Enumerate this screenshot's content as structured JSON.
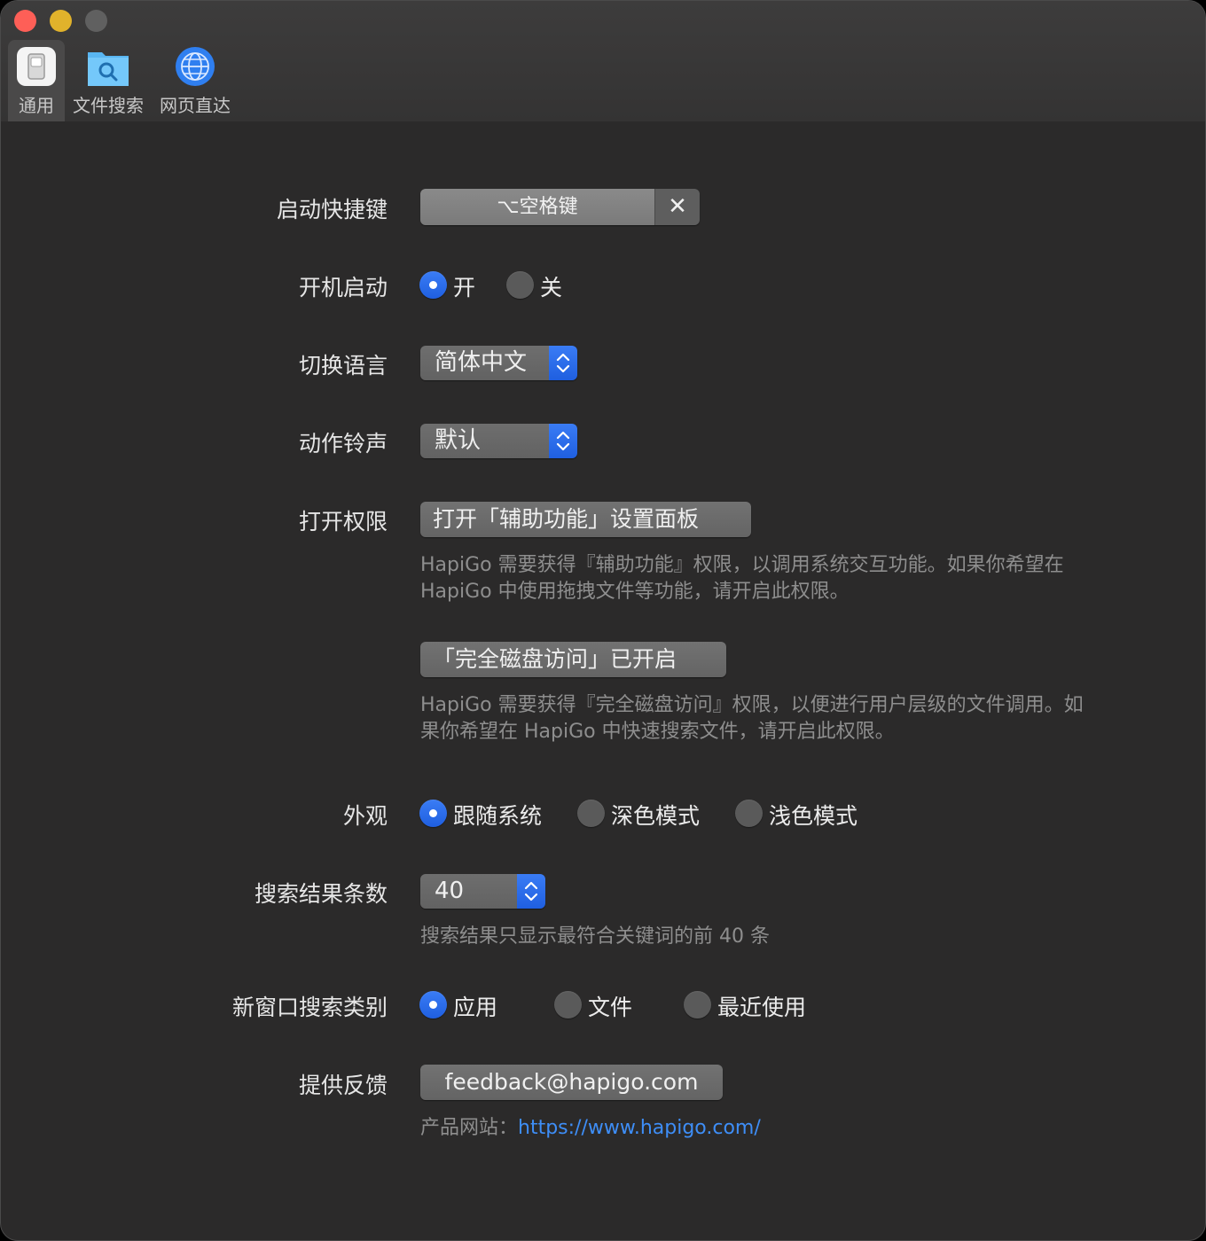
{
  "toolbar": {
    "tabs": [
      {
        "label": "通用",
        "icon": "switch-icon"
      },
      {
        "label": "文件搜索",
        "icon": "folder-search-icon"
      },
      {
        "label": "网页直达",
        "icon": "globe-icon"
      }
    ]
  },
  "settings": {
    "hotkey": {
      "label": "启动快捷键",
      "value": "⌥空格键",
      "clear": "✕"
    },
    "startup": {
      "label": "开机启动",
      "options": [
        "开",
        "关"
      ],
      "selected": "开"
    },
    "language": {
      "label": "切换语言",
      "value": "简体中文"
    },
    "sound": {
      "label": "动作铃声",
      "value": "默认"
    },
    "permissions": {
      "label": "打开权限",
      "accessibility_button": "打开「辅助功能」设置面板",
      "accessibility_desc_1": "HapiGo 需要获得『辅助功能』权限，以调用系统交互功能。如果你希望在",
      "accessibility_desc_2": "HapiGo 中使用拖拽文件等功能，请开启此权限。",
      "disk_button": "「完全磁盘访问」已开启",
      "disk_desc_1": "HapiGo 需要获得『完全磁盘访问』权限，以便进行用户层级的文件调用。如",
      "disk_desc_2": "果你希望在 HapiGo 中快速搜索文件，请开启此权限。"
    },
    "appearance": {
      "label": "外观",
      "options": [
        "跟随系统",
        "深色模式",
        "浅色模式"
      ],
      "selected": "跟随系统"
    },
    "result_count": {
      "label": "搜索结果条数",
      "value": "40",
      "desc": "搜索结果只显示最符合关键词的前 40 条"
    },
    "new_window_category": {
      "label": "新窗口搜索类别",
      "options": [
        "应用",
        "文件",
        "最近使用"
      ],
      "selected": "应用"
    },
    "feedback": {
      "label": "提供反馈",
      "button": "feedback@hapigo.com",
      "site_prefix": "产品网站：",
      "site_link": "https://www.hapigo.com/"
    }
  },
  "colors": {
    "accent": "#2a6cf0",
    "link": "#3e8ef7",
    "window_bg": "#2b2a2a"
  }
}
